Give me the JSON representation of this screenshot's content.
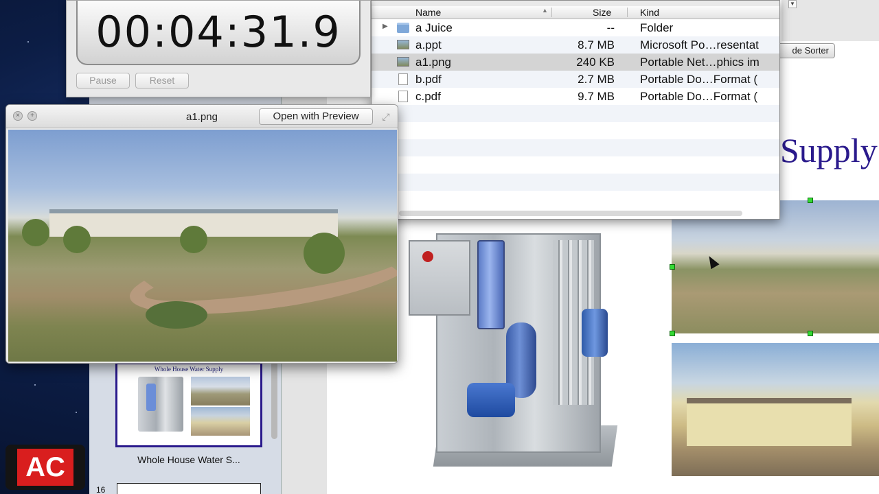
{
  "stopwatch": {
    "time": "00:04:31.9",
    "pause_label": "Pause",
    "reset_label": "Reset"
  },
  "quicklook": {
    "filename": "a1.png",
    "open_button_label": "Open with Preview"
  },
  "finder": {
    "columns": {
      "name": "Name",
      "size": "Size",
      "kind": "Kind"
    },
    "files": [
      {
        "name": "a Juice",
        "size": "--",
        "kind": "Folder",
        "icon": "folder-icon"
      },
      {
        "name": "a.ppt",
        "size": "8.7 MB",
        "kind": "Microsoft Po…resentat",
        "icon": "ppt-file-icon"
      },
      {
        "name": "a1.png",
        "size": "240 KB",
        "kind": "Portable Net…phics im",
        "icon": "png-file-icon"
      },
      {
        "name": "b.pdf",
        "size": "2.7 MB",
        "kind": "Portable Do…Format (",
        "icon": "pdf-file-icon"
      },
      {
        "name": "c.pdf",
        "size": "9.7 MB",
        "kind": "Portable Do…Format (",
        "icon": "pdf-file-icon"
      }
    ]
  },
  "keynote": {
    "toolbar_button": "de Sorter",
    "slide_title": "Supply",
    "thumb_title": "Whole House Water Supply",
    "slide_label": "Whole House Water S...",
    "next_slide_number": "16"
  },
  "logo": {
    "text": "AC"
  },
  "colors": {
    "accent_slide_title": "#2a1a8c",
    "selection_handle": "#35d935",
    "logo_red": "#d91e1e"
  }
}
